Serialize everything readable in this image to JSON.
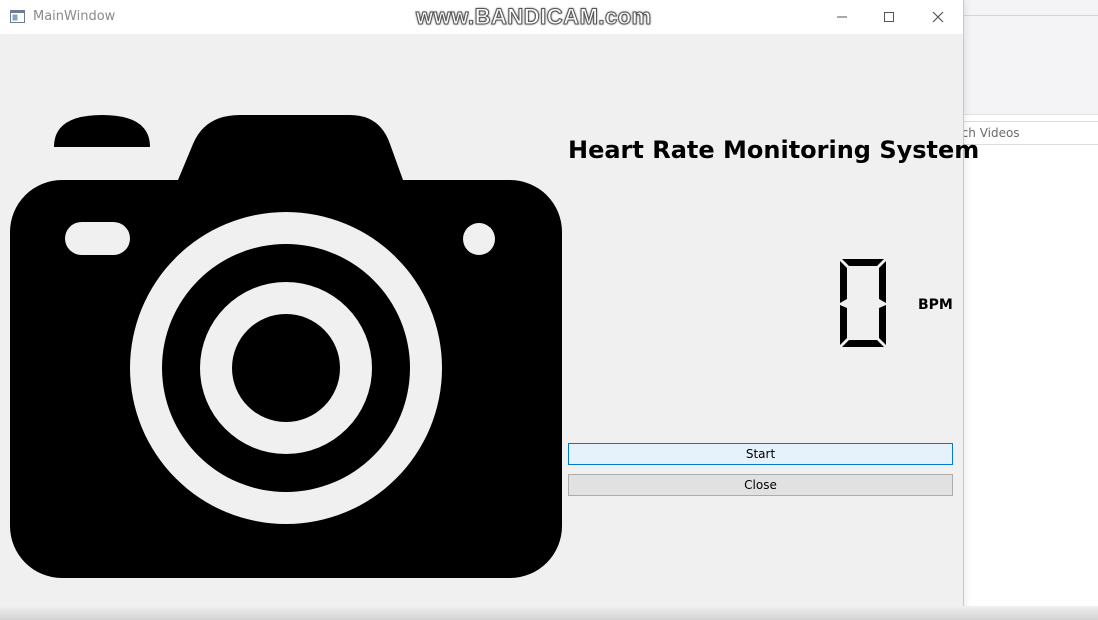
{
  "window": {
    "title": "MainWindow"
  },
  "watermark": "www.BANDICAM.com",
  "background_app": {
    "search_text": "rch Videos"
  },
  "app": {
    "title": "Heart Rate Monitoring System",
    "bpm_value": "0",
    "bpm_unit": "BPM",
    "start_label": "Start",
    "close_label": "Close"
  },
  "icons": {
    "camera": "camera-icon",
    "app": "window-app-icon",
    "minimize": "minimize-icon",
    "maximize": "maximize-icon",
    "close": "close-icon"
  },
  "colors": {
    "start_border": "#0078d7",
    "start_bg": "#e5f1fb",
    "close_bg": "#e1e1e1",
    "window_bg": "#f0f0f0",
    "camera": "#000000"
  }
}
